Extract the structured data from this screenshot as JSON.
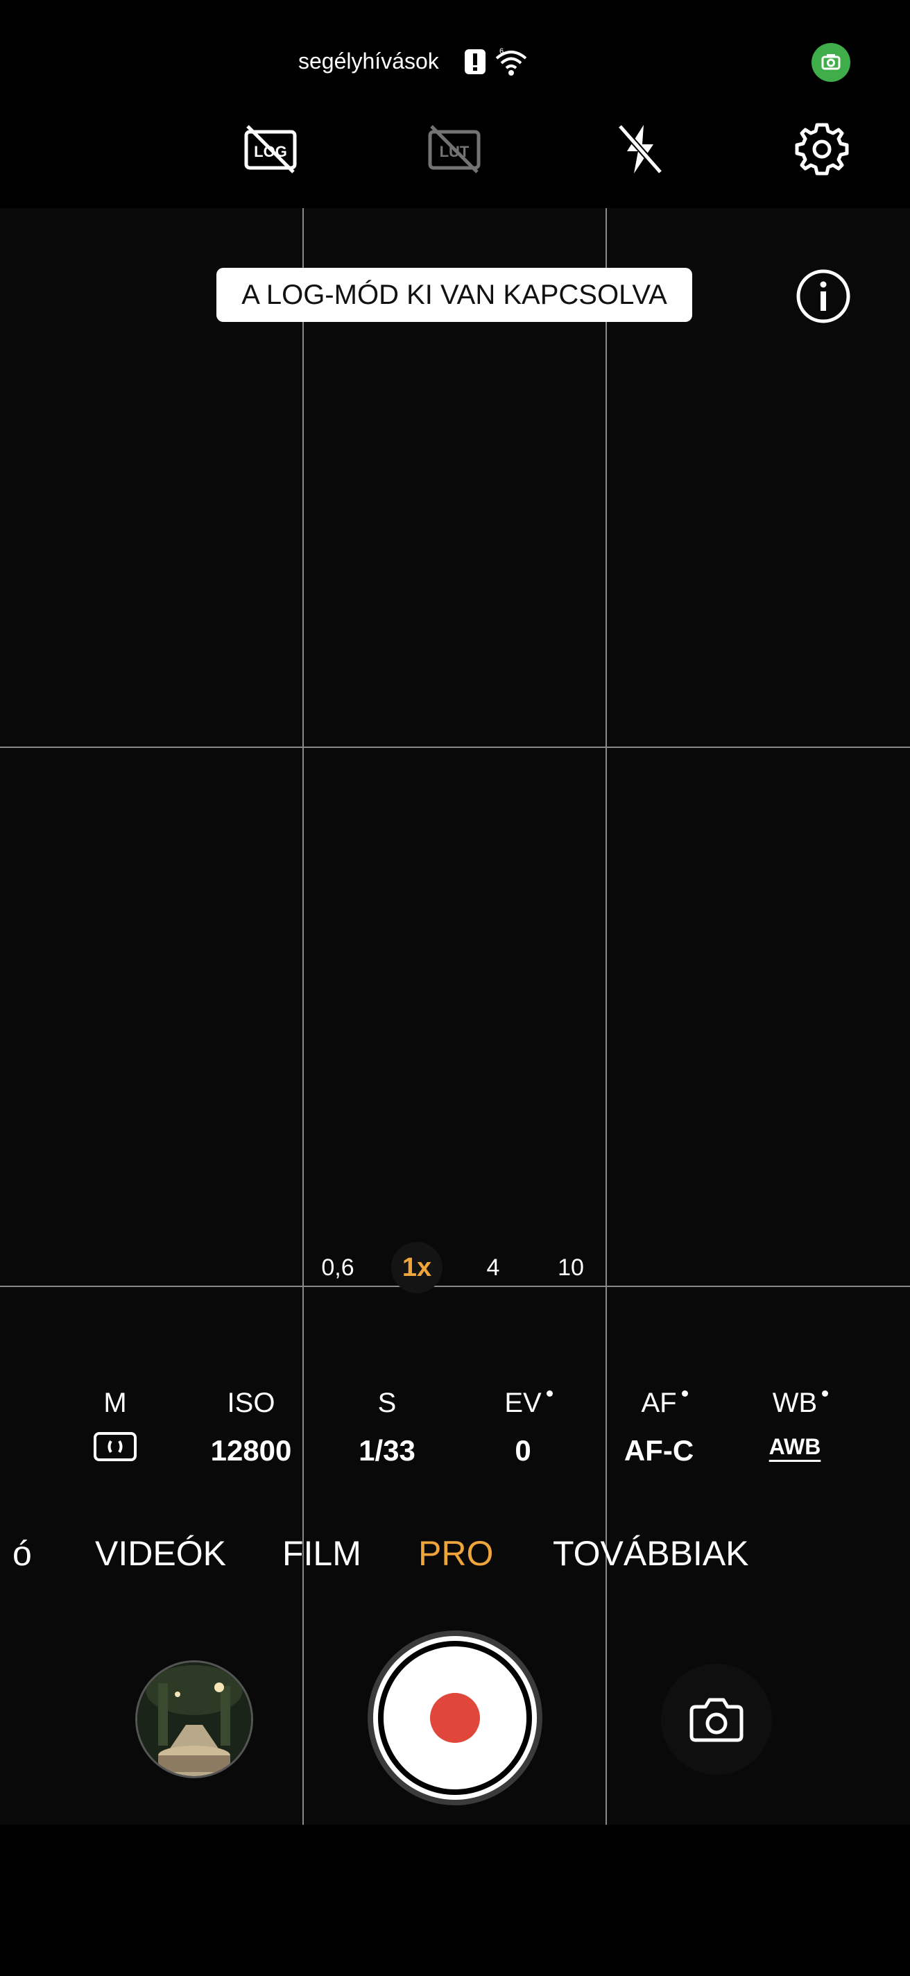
{
  "status_bar": {
    "text": "segélyhívások",
    "icons": [
      "warning-icon",
      "wifi-6-icon",
      "camera-in-use-icon"
    ]
  },
  "toolbar": {
    "icons": [
      "log-off-icon",
      "lut-off-icon",
      "flash-off-icon",
      "gear-icon"
    ]
  },
  "viewfinder": {
    "banner": "A LOG-MÓD KI VAN KAPCSOLVA",
    "info_icon": "info-icon"
  },
  "zoom": {
    "levels": [
      "0,6",
      "1x",
      "4",
      "10"
    ],
    "active": "1x"
  },
  "pro_params": [
    {
      "label": "M",
      "value": "",
      "icon": "metering-icon"
    },
    {
      "label": "ISO",
      "value": "12800"
    },
    {
      "label": "S",
      "value": "1/33"
    },
    {
      "label": "EV",
      "value": "0",
      "dot": true
    },
    {
      "label": "AF",
      "value": "AF-C",
      "dot": true
    },
    {
      "label": "WB",
      "value": "AWB",
      "dot": true
    }
  ],
  "modes": {
    "partial": "ó",
    "videos": "VIDEÓK",
    "film": "FILM",
    "pro": "PRO",
    "more": "TOVÁBBIAK",
    "active": "PRO"
  },
  "colors": {
    "accent": "#f0a53a",
    "record": "#e0463a",
    "camera_indicator": "#3fae4a"
  }
}
